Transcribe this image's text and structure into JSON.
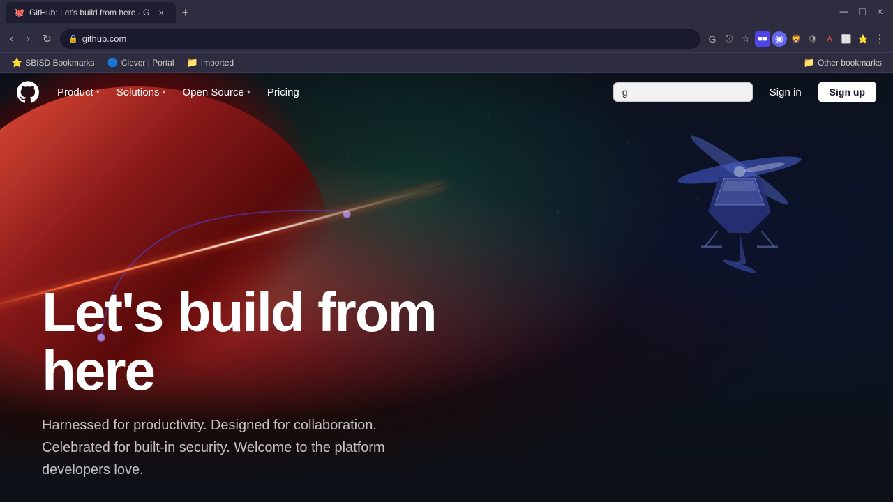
{
  "browser": {
    "tab": {
      "title": "GitHub: Let's build from here · G",
      "favicon": "🐙",
      "close_label": "×"
    },
    "new_tab_label": "+",
    "window_controls": [
      "─",
      "□",
      "×"
    ],
    "address_bar": {
      "url": "github.com",
      "lock_icon": "🔒"
    },
    "bookmarks": [
      {
        "label": "SBISD Bookmarks",
        "icon": "⭐"
      },
      {
        "label": "Clever | Portal",
        "icon": "🔵"
      },
      {
        "label": "Imported",
        "icon": "📁"
      }
    ],
    "bookmarks_right_label": "Other bookmarks"
  },
  "github": {
    "nav": {
      "logo_aria": "GitHub",
      "product_label": "Product",
      "solutions_label": "Solutions",
      "open_source_label": "Open Source",
      "pricing_label": "Pricing",
      "search_placeholder": "g",
      "search_value": "g",
      "sign_in_label": "Sign in",
      "sign_up_label": "Sign up"
    },
    "hero": {
      "title": "Let's build from here",
      "subtitle": "Harnessed for productivity. Designed for collaboration. Celebrated for built-in security. Welcome to the platform developers love."
    }
  }
}
